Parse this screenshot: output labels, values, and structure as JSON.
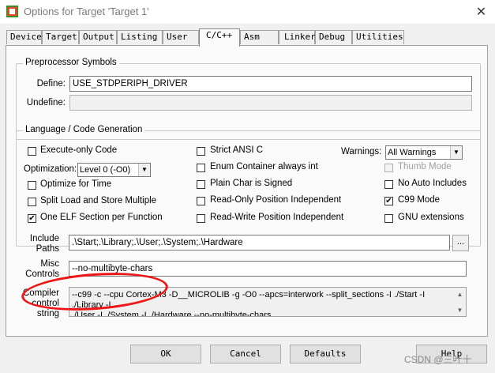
{
  "window": {
    "title": "Options for Target 'Target 1'",
    "close_glyph": "✕",
    "app_icon": "keil-uvision-icon"
  },
  "tabs": [
    {
      "label": "Device",
      "active": false
    },
    {
      "label": "Target",
      "active": false
    },
    {
      "label": "Output",
      "active": false
    },
    {
      "label": "Listing",
      "active": false
    },
    {
      "label": "User",
      "active": false
    },
    {
      "label": "C/C++",
      "active": true
    },
    {
      "label": "Asm",
      "active": false
    },
    {
      "label": "Linker",
      "active": false
    },
    {
      "label": "Debug",
      "active": false
    },
    {
      "label": "Utilities",
      "active": false
    }
  ],
  "preprocessor": {
    "title": "Preprocessor Symbols",
    "define_label": "Define:",
    "define_value": "USE_STDPERIPH_DRIVER",
    "undefine_label": "Undefine:",
    "undefine_value": ""
  },
  "codegen": {
    "title": "Language / Code Generation",
    "execute_only": {
      "label": "Execute-only Code",
      "checked": false
    },
    "optimization_label": "Optimization:",
    "optimization_value": "Level 0 (-O0)",
    "optimize_time": {
      "label": "Optimize for Time",
      "checked": false
    },
    "split_load": {
      "label": "Split Load and Store Multiple",
      "checked": false
    },
    "one_elf": {
      "label": "One ELF Section per Function",
      "checked": true
    },
    "strict_ansi": {
      "label": "Strict ANSI C",
      "checked": false
    },
    "enum_int": {
      "label": "Enum Container always int",
      "checked": false
    },
    "plain_char": {
      "label": "Plain Char is Signed",
      "checked": false
    },
    "ro_pi": {
      "label": "Read-Only Position Independent",
      "checked": false
    },
    "rw_pi": {
      "label": "Read-Write Position Independent",
      "checked": false
    },
    "warnings_label": "Warnings:",
    "warnings_value": "All Warnings",
    "thumb_mode": {
      "label": "Thumb Mode",
      "checked": false,
      "disabled": true
    },
    "no_auto_includes": {
      "label": "No Auto Includes",
      "checked": false
    },
    "c99_mode": {
      "label": "C99 Mode",
      "checked": true
    },
    "gnu_ext": {
      "label": "GNU extensions",
      "checked": false
    }
  },
  "include": {
    "label_line1": "Include",
    "label_line2": "Paths",
    "value": ".\\Start;.\\Library;.\\User;.\\System;.\\Hardware",
    "browse_label": "..."
  },
  "misc": {
    "label_line1": "Misc",
    "label_line2": "Controls",
    "value": "--no-multibyte-chars"
  },
  "compiler": {
    "label_line1": "Compiler",
    "label_line2": "control",
    "label_line3": "string",
    "line1": "--c99 -c --cpu Cortex-M3 -D__MICROLIB -g -O0 --apcs=interwork --split_sections -I ./Start -I ./Library -I",
    "line2": "./User -I ./System -I ./Hardware --no-multibyte-chars"
  },
  "buttons": {
    "ok": "OK",
    "cancel": "Cancel",
    "defaults": "Defaults",
    "help": "Help"
  },
  "watermark": "CSDN @三叶十",
  "colors": {
    "annotation_red": "#ee1515",
    "dialog_bg": "#f0f0f0"
  }
}
